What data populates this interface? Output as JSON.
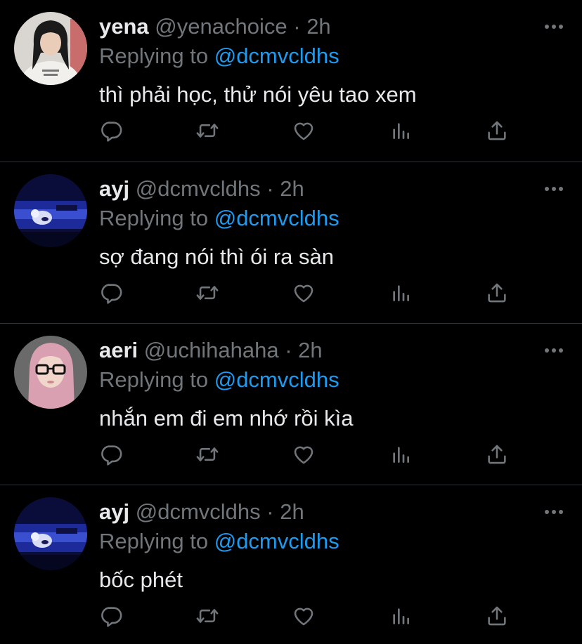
{
  "colors": {
    "background": "#000000",
    "text": "#e7e9ea",
    "secondary": "#71767b",
    "link": "#1d9bf0",
    "divider": "#2f3336"
  },
  "icons": {
    "more": "more-horizontal-icon",
    "reply": "reply-icon",
    "retweet": "retweet-icon",
    "like": "heart-icon",
    "views": "views-icon",
    "share": "share-icon"
  },
  "tweets": [
    {
      "name": "yena",
      "handle": "@yenachoice",
      "separator": "·",
      "time": "2h",
      "reply_prefix": "Replying to",
      "reply_to": "@dcmvcldhs",
      "text": "thì phải học, thử nói yêu tao xem"
    },
    {
      "name": "ayj",
      "handle": "@dcmvcldhs",
      "separator": "·",
      "time": "2h",
      "reply_prefix": "Replying to",
      "reply_to": "@dcmvcldhs",
      "text": "sợ đang nói thì ói ra sàn"
    },
    {
      "name": "aeri",
      "handle": "@uchihahaha",
      "separator": "·",
      "time": "2h",
      "reply_prefix": "Replying to",
      "reply_to": "@dcmvcldhs",
      "text": "nhắn em đi em nhớ rồi kìa"
    },
    {
      "name": "ayj",
      "handle": "@dcmvcldhs",
      "separator": "·",
      "time": "2h",
      "reply_prefix": "Replying to",
      "reply_to": "@dcmvcldhs",
      "text": "bốc phét"
    }
  ]
}
